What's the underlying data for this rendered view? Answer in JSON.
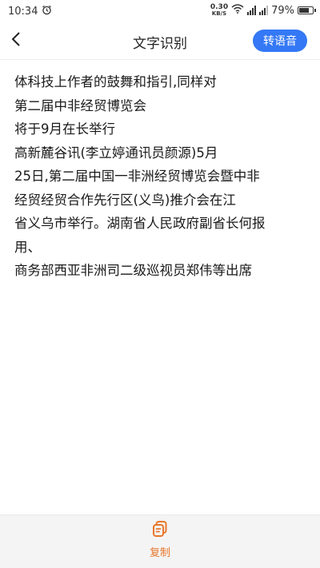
{
  "status_bar": {
    "time": "10:34",
    "net_speed_value": "0.30",
    "net_speed_unit": "KB/S",
    "battery_percent": "79%",
    "battery_level": 0.79
  },
  "header": {
    "title": "文字识别",
    "convert_button_label": "转语音"
  },
  "content": {
    "lines": [
      "体科技上作者的鼓舞和指引,同样对",
      "第二届中非经贸博览会",
      "将于9月在长举行",
      "高新麓谷讯(李立婷通讯员颜源)5月",
      "25日,第二届中国一非洲经贸博览会暨中非",
      "经贸经贸合作先行区(义鸟)推介会在江",
      "省义乌市举行。湖南省人民政府副省长何报",
      "用、",
      "商务部西亚非洲司二级巡视员郑伟等出席"
    ]
  },
  "bottom_bar": {
    "copy_label": "复制",
    "accent_color": "#e8762b"
  },
  "colors": {
    "primary": "#3478f6",
    "text": "#1a1a1a",
    "bottom_bar_bg": "#f4f4f4"
  }
}
